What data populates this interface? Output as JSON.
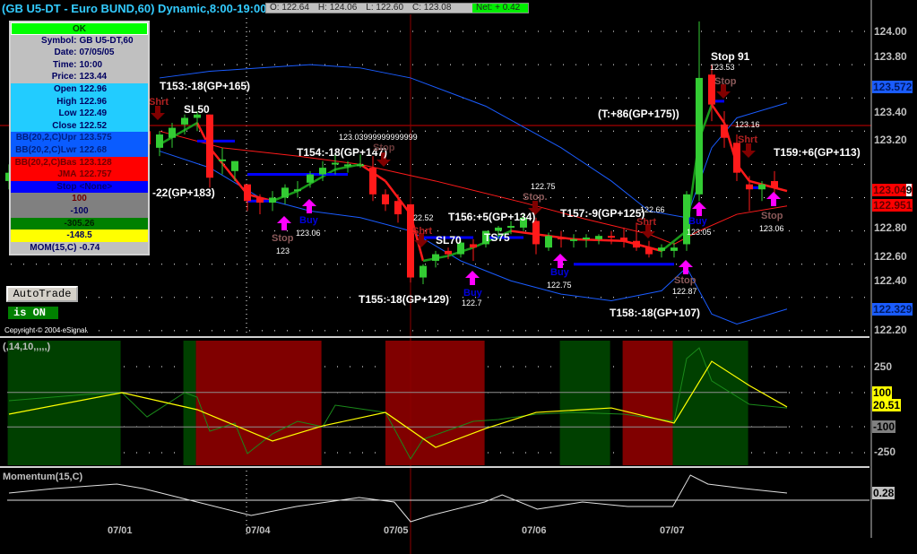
{
  "header": {
    "title": "(GB U5-DT - Euro BUND,60) Dynamic,8:00-19:00"
  },
  "ohlc_bar": {
    "open": "O: 122.64",
    "high": "H: 124.06",
    "low": "L: 122.60",
    "close": "C: 123.08",
    "net": "Net: + 0.42"
  },
  "info_panel": {
    "status": "OK",
    "rows": [
      {
        "k": "Symbol:",
        "v": "GB U5-DT,60"
      },
      {
        "k": "Date:",
        "v": "07/05/05"
      },
      {
        "k": "Time:",
        "v": "10:00"
      },
      {
        "k": "Price:",
        "v": "123.44"
      },
      {
        "k": "Open",
        "v": "122.96"
      },
      {
        "k": "High",
        "v": "122.96"
      },
      {
        "k": "Low",
        "v": "122.49"
      },
      {
        "k": "Close",
        "v": "122.52"
      },
      {
        "k": "BB(20,2,C)Upr",
        "v": "123.575"
      },
      {
        "k": "BB(20,2,C)Lwr",
        "v": "122.68"
      },
      {
        "k": "BB(20,2,C)Bas",
        "v": "123.128"
      },
      {
        "k": "JMA",
        "v": "122.757"
      },
      {
        "k": "Stop",
        "v": "<None>"
      }
    ],
    "osc_values": [
      "100",
      "-100",
      "-305.26",
      "-148.5"
    ],
    "mom": {
      "k": "MOM(15,C)",
      "v": "-0.74"
    }
  },
  "autotrade": {
    "button": "AutoTrade",
    "status": "is ON"
  },
  "copyright": "Copyright © 2004 eSignal.",
  "price_axis": {
    "ticks": [
      "124.00",
      "123.80",
      "123.40",
      "123.20",
      "122.80",
      "122.60",
      "122.40",
      "122.20"
    ],
    "badges": {
      "bb_upper": "123.572",
      "last": "123.04",
      "last_suffix": "9",
      "bb_basis": "122.951",
      "bb_lower": "122.329"
    }
  },
  "osc_axis": {
    "ticks": [
      "250",
      "-250"
    ],
    "badges": {
      "upper": "100",
      "value": "20.51",
      "lower": "-100"
    }
  },
  "mom_axis": {
    "badge": "0.28"
  },
  "date_labels": [
    "07/01",
    "07/04",
    "07/05",
    "07/06",
    "07/07"
  ],
  "panels": {
    "osc_title": "(,14,10,,,,,)",
    "mom_title": "Momentum(15,C)"
  },
  "annotations": {
    "t153": "T153:-18(GP+165)",
    "shrt1": "Shrt",
    "sl50": "SL50",
    "gp183": "-22(GP+183)",
    "long_num": "123.03999999999999",
    "t154": "T154:-18(GP+147)",
    "stop_hidden": "Stop",
    "stop1": "Stop",
    "stop1_price": "123",
    "buy1": "Buy",
    "buy1_price": "123.06",
    "p2252": "22.52",
    "shrt2": "Shrt",
    "sl70": "SL70",
    "ts75": "TS75",
    "t156": "T156:+5(GP+134)",
    "p12275": "122.75",
    "stop2": "Stop.",
    "t155": "T155:-18(GP+129)",
    "buy2": "Buy",
    "buy2_price": "122.7",
    "buy3": "Buy",
    "buy3_price": "122.75",
    "t157": "T157:-9(GP+125)",
    "p12266": "122.66",
    "shrt3": "Shrt",
    "buy4": "Buy",
    "buy4_price": "123.05",
    "stop3": "Stop",
    "stop3_price": "122.87",
    "t158": "T158:-18(GP+107)",
    "t_total": "(T:+86(GP+175))",
    "stop91": "Stop 91",
    "stop91_price": "123.53",
    "stop4": "Stop",
    "p12316": "123.16",
    "shrt4": "Shrt",
    "t159": "T159:+6(GP+113)",
    "stop5": "Stop",
    "stop5_price": "123.06"
  },
  "colors": {
    "bull": "#33cc33",
    "bear": "#ff1a1a",
    "band": "#1a5cff",
    "basis": "#ff1a1a",
    "buy_arrow": "#ff00ff",
    "sell_arrow": "#800000",
    "bull_zone": "#004000",
    "bear_zone": "#800000"
  },
  "chart_data": {
    "type": "candlestick",
    "price_range": [
      122.2,
      124.0
    ],
    "crosshair_price": 123.44,
    "crosshair_bar": 32,
    "ohlc": [
      [
        123.1,
        123.2,
        123.05,
        123.15
      ],
      [
        123.15,
        123.28,
        123.1,
        123.25
      ],
      [
        123.25,
        123.3,
        123.18,
        123.22
      ],
      [
        123.22,
        123.35,
        123.2,
        123.32
      ],
      [
        123.32,
        123.4,
        123.28,
        123.36
      ],
      [
        123.36,
        123.45,
        123.3,
        123.42
      ],
      [
        123.42,
        123.48,
        123.35,
        123.38
      ],
      [
        123.38,
        123.46,
        123.33,
        123.44
      ],
      [
        123.44,
        123.52,
        123.4,
        123.48
      ],
      [
        123.48,
        123.55,
        123.42,
        123.45
      ],
      [
        123.45,
        123.5,
        123.36,
        123.4
      ],
      [
        123.4,
        123.45,
        123.28,
        123.32
      ],
      [
        123.3,
        123.4,
        123.25,
        123.38
      ],
      [
        123.36,
        123.45,
        123.3,
        123.42
      ],
      [
        123.44,
        123.5,
        123.38,
        123.48
      ],
      [
        123.48,
        123.52,
        123.4,
        123.5
      ],
      [
        123.5,
        123.5,
        123.06,
        123.12
      ],
      [
        123.22,
        123.3,
        123.14,
        123.23
      ],
      [
        123.16,
        123.22,
        123.1,
        123.22
      ],
      [
        123.08,
        123.08,
        122.92,
        122.98
      ],
      [
        123.0,
        123.02,
        122.9,
        122.97
      ],
      [
        122.97,
        123.04,
        122.92,
        123.0
      ],
      [
        123.0,
        123.08,
        122.96,
        123.06
      ],
      [
        123.04,
        123.1,
        123.0,
        123.05
      ],
      [
        123.09,
        123.16,
        123.06,
        123.14
      ],
      [
        123.14,
        123.22,
        123.1,
        123.18
      ],
      [
        123.2,
        123.27,
        123.14,
        123.21
      ],
      [
        123.19,
        123.22,
        123.15,
        123.2
      ],
      [
        123.2,
        123.26,
        123.18,
        123.2
      ],
      [
        123.18,
        123.25,
        122.98,
        123.02
      ],
      [
        123.02,
        123.05,
        122.92,
        122.96
      ],
      [
        122.98,
        123.02,
        122.85,
        122.9
      ],
      [
        122.96,
        122.96,
        122.49,
        122.52
      ],
      [
        122.52,
        122.6,
        122.48,
        122.59
      ],
      [
        122.62,
        122.68,
        122.58,
        122.66
      ],
      [
        122.68,
        122.7,
        122.63,
        122.66
      ],
      [
        122.66,
        122.74,
        122.64,
        122.73
      ],
      [
        122.72,
        122.75,
        122.62,
        122.7
      ],
      [
        122.72,
        122.8,
        122.7,
        122.8
      ],
      [
        122.8,
        122.83,
        122.75,
        122.82
      ],
      [
        122.82,
        122.86,
        122.78,
        122.83
      ],
      [
        122.82,
        122.9,
        122.8,
        122.88
      ],
      [
        122.86,
        122.88,
        122.66,
        122.72
      ],
      [
        122.7,
        122.79,
        122.68,
        122.77
      ],
      [
        122.76,
        122.8,
        122.7,
        122.75
      ],
      [
        122.74,
        122.78,
        122.7,
        122.75
      ],
      [
        122.75,
        122.78,
        122.7,
        122.76
      ],
      [
        122.75,
        122.78,
        122.72,
        122.77
      ],
      [
        122.77,
        122.8,
        122.72,
        122.76
      ],
      [
        122.76,
        122.82,
        122.7,
        122.74
      ],
      [
        122.74,
        122.85,
        122.68,
        122.7
      ],
      [
        122.7,
        122.74,
        122.64,
        122.66
      ],
      [
        122.68,
        122.72,
        122.64,
        122.7
      ],
      [
        122.68,
        122.73,
        122.64,
        122.7
      ],
      [
        122.72,
        123.04,
        122.68,
        123.02
      ],
      [
        123.02,
        124.06,
        122.98,
        123.72
      ],
      [
        123.74,
        123.8,
        123.46,
        123.56
      ],
      [
        123.44,
        123.52,
        123.3,
        123.36
      ],
      [
        123.33,
        123.38,
        123.1,
        123.15
      ],
      [
        123.08,
        123.13,
        122.92,
        123.05
      ],
      [
        123.05,
        123.1,
        122.98,
        123.08
      ],
      [
        123.1,
        123.16,
        123.0,
        123.06
      ]
    ],
    "bb_upper": [
      [
        12,
        123.72
      ],
      [
        16,
        123.76
      ],
      [
        20,
        123.78
      ],
      [
        24,
        123.8
      ],
      [
        28,
        123.78
      ],
      [
        32,
        123.72
      ],
      [
        38,
        123.55
      ],
      [
        44,
        123.3
      ],
      [
        48,
        123.1
      ],
      [
        51,
        122.92
      ],
      [
        54,
        122.88
      ],
      [
        56,
        123.3
      ],
      [
        58,
        123.48
      ],
      [
        62,
        123.57
      ]
    ],
    "bb_lower": [
      [
        12,
        123.28
      ],
      [
        16,
        123.18
      ],
      [
        20,
        123.0
      ],
      [
        24,
        122.92
      ],
      [
        28,
        122.88
      ],
      [
        32,
        122.8
      ],
      [
        36,
        122.62
      ],
      [
        40,
        122.5
      ],
      [
        44,
        122.42
      ],
      [
        48,
        122.38
      ],
      [
        52,
        122.44
      ],
      [
        54,
        122.58
      ],
      [
        56,
        122.3
      ],
      [
        58,
        122.24
      ],
      [
        62,
        122.33
      ]
    ],
    "bb_basis": [
      [
        12,
        123.4
      ],
      [
        17,
        123.3
      ],
      [
        23,
        123.25
      ],
      [
        28,
        123.2
      ],
      [
        34,
        123.1
      ],
      [
        41,
        122.97
      ],
      [
        46,
        122.87
      ],
      [
        51,
        122.78
      ],
      [
        53,
        122.72
      ],
      [
        55,
        122.8
      ],
      [
        58,
        122.9
      ],
      [
        62,
        122.95
      ]
    ],
    "jma": [
      [
        12,
        123.32
      ],
      [
        15,
        123.45
      ],
      [
        16,
        123.3
      ],
      [
        19,
        123.02
      ],
      [
        21,
        122.98
      ],
      [
        23,
        123.04
      ],
      [
        26,
        123.17
      ],
      [
        28,
        123.2
      ],
      [
        30,
        123.1
      ],
      [
        32,
        122.9
      ],
      [
        33,
        122.62
      ],
      [
        35,
        122.65
      ],
      [
        37,
        122.7
      ],
      [
        40,
        122.8
      ],
      [
        42,
        122.78
      ],
      [
        45,
        122.75
      ],
      [
        49,
        122.74
      ],
      [
        52,
        122.68
      ],
      [
        54,
        122.8
      ],
      [
        55,
        123.35
      ],
      [
        56,
        123.56
      ],
      [
        57,
        123.45
      ],
      [
        58,
        123.2
      ],
      [
        59,
        123.1
      ],
      [
        61,
        123.06
      ],
      [
        62,
        123.04
      ]
    ],
    "stops": [
      [
        7,
        11,
        123.62
      ],
      [
        15,
        18,
        123.34
      ],
      [
        19,
        21,
        122.98
      ],
      [
        19,
        27,
        123.14
      ],
      [
        33,
        37,
        122.76
      ],
      [
        38,
        41,
        122.76
      ],
      [
        45,
        53,
        122.6
      ],
      [
        56,
        57,
        123.58
      ],
      [
        59,
        60,
        123.06
      ]
    ],
    "osc_range": [
      -350,
      350
    ],
    "osc_levels": [
      100,
      -100
    ],
    "osc_zones": [
      [
        -0.1,
        8.9,
        "bull"
      ],
      [
        13.9,
        14.9,
        "bull"
      ],
      [
        14.9,
        24.9,
        "bear"
      ],
      [
        30,
        37.9,
        "bear"
      ],
      [
        43.9,
        47.9,
        "bull"
      ],
      [
        48.9,
        52.9,
        "bear"
      ],
      [
        52.9,
        58.9,
        "bull"
      ]
    ],
    "osc_slow": [
      [
        0,
        -26
      ],
      [
        9,
        99
      ],
      [
        15,
        0
      ],
      [
        21,
        -182
      ],
      [
        25,
        -94
      ],
      [
        30,
        -16
      ],
      [
        34,
        -219
      ],
      [
        38,
        -109
      ],
      [
        42,
        -16
      ],
      [
        48,
        10
      ],
      [
        53,
        -78
      ],
      [
        56,
        281
      ],
      [
        59,
        140
      ],
      [
        62,
        16
      ]
    ],
    "osc_fast": [
      [
        0,
        52
      ],
      [
        6,
        88
      ],
      [
        9,
        99
      ],
      [
        11,
        -42
      ],
      [
        14,
        99
      ],
      [
        15,
        73
      ],
      [
        16,
        -125
      ],
      [
        18,
        -78
      ],
      [
        19,
        -255
      ],
      [
        21,
        -140
      ],
      [
        23,
        -68
      ],
      [
        25,
        -99
      ],
      [
        26,
        26
      ],
      [
        30,
        -16
      ],
      [
        32,
        -286
      ],
      [
        33,
        -172
      ],
      [
        37,
        -68
      ],
      [
        39,
        -57
      ],
      [
        42,
        -26
      ],
      [
        45,
        -16
      ],
      [
        49,
        -26
      ],
      [
        51,
        -47
      ],
      [
        53,
        -68
      ],
      [
        54,
        297
      ],
      [
        55,
        359
      ],
      [
        56,
        167
      ],
      [
        59,
        31
      ],
      [
        62,
        10
      ]
    ],
    "momentum": [
      [
        0,
        0.32
      ],
      [
        3.6,
        0.52
      ],
      [
        8.6,
        0.72
      ],
      [
        10.7,
        0.52
      ],
      [
        15,
        -0.08
      ],
      [
        19.3,
        -0.68
      ],
      [
        22.9,
        -0.28
      ],
      [
        27.9,
        0.12
      ],
      [
        30.7,
        -0.08
      ],
      [
        32,
        -0.96
      ],
      [
        33.6,
        -0.68
      ],
      [
        37.9,
        -0.08
      ],
      [
        39.3,
        0.24
      ],
      [
        42.1,
        -0.4
      ],
      [
        45.7,
        -0.08
      ],
      [
        49.3,
        -0.28
      ],
      [
        52.9,
        -0.28
      ],
      [
        54.3,
        1.12
      ],
      [
        55.7,
        0.72
      ],
      [
        58.6,
        0.52
      ],
      [
        62,
        0.32
      ]
    ]
  }
}
